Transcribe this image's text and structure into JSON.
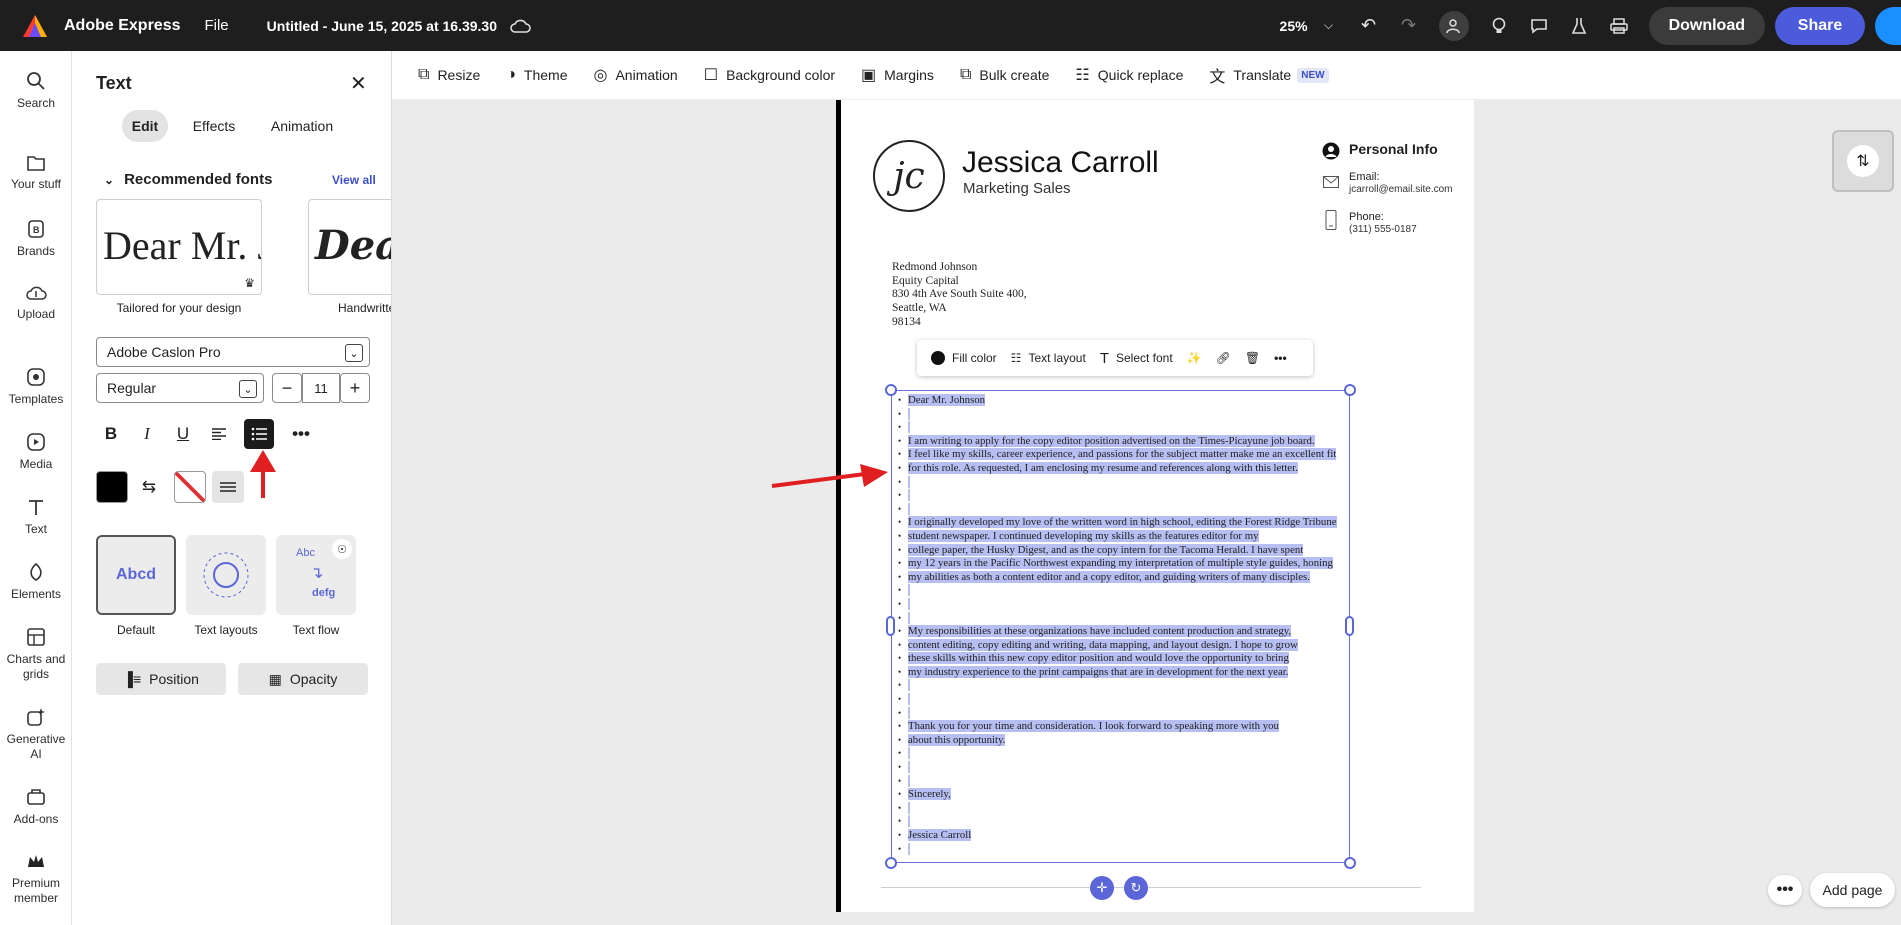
{
  "topbar": {
    "app_name": "Adobe Express",
    "file_menu": "File",
    "doc_title": "Untitled - June 15, 2025 at 16.39.30",
    "zoom": "25%",
    "download": "Download",
    "share": "Share"
  },
  "rail": [
    {
      "label": "Search",
      "icon": "search-icon"
    },
    {
      "label": "Your stuff",
      "icon": "folder-icon"
    },
    {
      "label": "Brands",
      "icon": "brand-icon"
    },
    {
      "label": "Upload",
      "icon": "upload-icon"
    },
    {
      "label": "Templates",
      "icon": "templates-icon"
    },
    {
      "label": "Media",
      "icon": "media-icon"
    },
    {
      "label": "Text",
      "icon": "text-icon"
    },
    {
      "label": "Elements",
      "icon": "elements-icon"
    },
    {
      "label": "Charts and grids",
      "icon": "chart-icon"
    },
    {
      "label": "Generative AI",
      "icon": "sparkle-icon"
    },
    {
      "label": "Add-ons",
      "icon": "addons-icon"
    },
    {
      "label": "Premium member",
      "icon": "crown-icon"
    }
  ],
  "panel": {
    "title": "Text",
    "tabs": [
      "Edit",
      "Effects",
      "Animation"
    ],
    "active_tab": "Edit",
    "recommended_title": "Recommended fonts",
    "view_all": "View all",
    "font_cards": [
      {
        "sample": "Dear Mr. Johnson",
        "caption": "Tailored for your design"
      },
      {
        "sample": "Dear Mr.",
        "caption": "Handwritten"
      }
    ],
    "font_family": "Adobe Caslon Pro",
    "font_weight": "Regular",
    "font_size": "11",
    "text_styles": [
      {
        "label": "Default",
        "preview": "Abcd"
      },
      {
        "label": "Text layouts"
      },
      {
        "label": "Text flow",
        "preview_top": "Abc",
        "preview_bottom": "defg"
      }
    ],
    "position_btn": "Position",
    "opacity_btn": "Opacity",
    "accent_color": "#5b67d9"
  },
  "canvas_toolbar": {
    "items": [
      {
        "label": "Resize",
        "icon": "resize-icon"
      },
      {
        "label": "Theme",
        "icon": "theme-icon"
      },
      {
        "label": "Animation",
        "icon": "animation-icon"
      },
      {
        "label": "Background color",
        "icon": "checkbox-icon"
      },
      {
        "label": "Margins",
        "icon": "margins-icon"
      },
      {
        "label": "Bulk create",
        "icon": "bulk-icon"
      },
      {
        "label": "Quick replace",
        "icon": "replace-icon"
      },
      {
        "label": "Translate",
        "icon": "translate-icon"
      }
    ],
    "new_badge": "NEW"
  },
  "float_toolbar": {
    "fill_color": "Fill color",
    "text_layout": "Text layout",
    "select_font": "Select font"
  },
  "letter": {
    "monogram": "jc",
    "name": "Jessica Carroll",
    "role": "Marketing Sales",
    "personal_info": "Personal Info",
    "email_label": "Email:",
    "email": "jcarroll@email.site.com",
    "phone_label": "Phone:",
    "phone": "(311) 555-0187",
    "address": [
      "Redmond Johnson",
      "Equity Capital",
      "830 4th Ave South Suite 400,",
      "Seattle, WA",
      "98134"
    ],
    "body": [
      "Dear  Mr. Johnson",
      "",
      "",
      "I am writing to apply for the copy editor position advertised on the Times-Picayune job board.",
      "I feel like my skills, career experience, and passions for the subject matter make me an excellent fit",
      "for this role. As requested, I am enclosing my resume and references along with this letter.",
      "",
      "",
      "",
      "I originally developed my love of the written word in high school, editing the Forest Ridge Tribune",
      "student newspaper. I continued developing my skills as the features editor for my",
      "college paper, the Husky Digest, and as the copy intern for the Tacoma Herald. I have spent",
      "my 12 years in the Pacific Northwest expanding my interpretation of multiple style guides, honing",
      "my abilities as both a content editor and a copy editor, and guiding writers of many disciples.",
      "",
      "",
      "",
      "My responsibilities at these organizations have included content production and strategy,",
      "content editing, copy editing and writing, data mapping, and layout design. I hope to grow",
      "these skills within this new copy editor position and would love the opportunity to bring",
      "my industry experience to the print campaigns that are in development for the next year.",
      "",
      "",
      "",
      "Thank you for your time and consideration. I look forward to speaking more with you",
      "about this opportunity.",
      "",
      "",
      "",
      "Sincerely,",
      "",
      "",
      "Jessica Carroll",
      ""
    ]
  },
  "add_page": "Add page"
}
